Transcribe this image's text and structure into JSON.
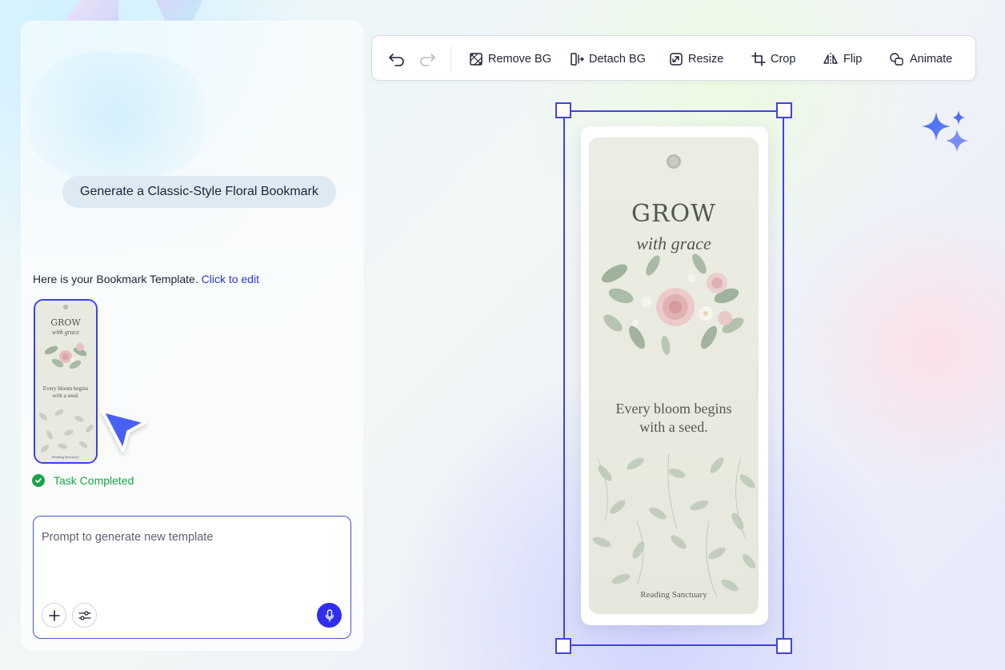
{
  "chat": {
    "user_message": "Generate a Classic-Style Floral Bookmark",
    "reply_text": "Here is your Bookmark Template.",
    "reply_link": "Click to edit",
    "status": "Task Completed"
  },
  "prompt": {
    "placeholder": "Prompt to generate new template"
  },
  "toolbar": {
    "remove_bg": "Remove BG",
    "detach_bg": "Detach BG",
    "resize": "Resize",
    "crop": "Crop",
    "flip": "Flip",
    "animate": "Animate"
  },
  "bookmark": {
    "title": "GROW",
    "script": "with grace",
    "quote_line1": "Every bloom begins",
    "quote_line2": "with a seed.",
    "footer": "Reading Sanctuary"
  },
  "colors": {
    "accent": "#3f43e4",
    "success": "#17a34a",
    "mic_button": "#2f2df0"
  }
}
